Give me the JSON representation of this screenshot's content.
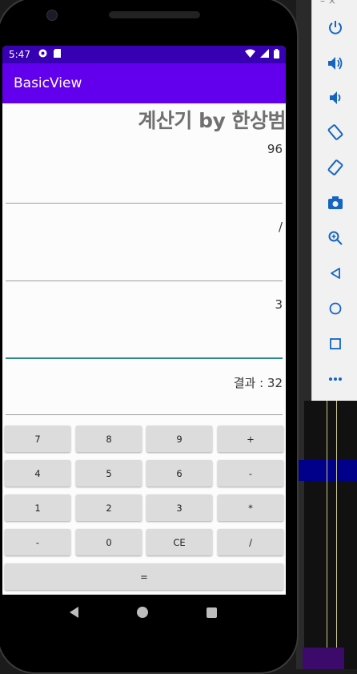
{
  "status_bar": {
    "time": "5:47"
  },
  "app_bar": {
    "title": "BasicView"
  },
  "calculator": {
    "heading": "계산기 by 한상범",
    "operand1": "96",
    "operator": "/",
    "operand2": "3",
    "result": "결과 : 32"
  },
  "keypad": {
    "rows": [
      [
        "7",
        "8",
        "9",
        "+"
      ],
      [
        "4",
        "5",
        "6",
        "-"
      ],
      [
        "1",
        "2",
        "3",
        "*"
      ],
      [
        "-",
        "0",
        "CE",
        "/"
      ]
    ],
    "equals": "="
  },
  "toolbar": {
    "window_controls": "–  ×",
    "icons": [
      "power-icon",
      "volume-up-icon",
      "volume-down-icon",
      "rotate-left-icon",
      "rotate-right-icon",
      "camera-icon",
      "zoom-icon",
      "back-icon",
      "home-icon",
      "overview-icon",
      "more-icon"
    ]
  },
  "colors": {
    "status_bar": "#3700b3",
    "app_bar": "#6200ee",
    "active_underline": "#2e8b8b",
    "button": "#dcdcdc"
  }
}
